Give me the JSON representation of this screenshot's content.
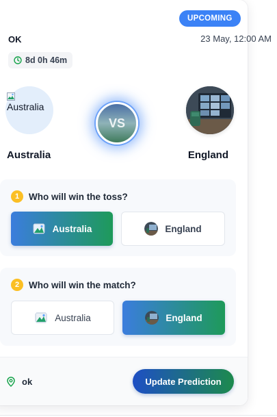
{
  "match": {
    "status_badge": "UPCOMING",
    "name": "OK",
    "datetime": "23 May, 12:00 AM",
    "countdown": "8d 0h 46m",
    "vs_label": "VS"
  },
  "teams": {
    "a": {
      "name": "Australia",
      "avatar_alt": "Australia"
    },
    "b": {
      "name": "England"
    }
  },
  "questions": [
    {
      "number": "1",
      "text": "Who will win the toss?",
      "options": [
        {
          "label": "Australia",
          "selected": true
        },
        {
          "label": "England",
          "selected": false
        }
      ]
    },
    {
      "number": "2",
      "text": "Who will win the match?",
      "options": [
        {
          "label": "Australia",
          "selected": false
        },
        {
          "label": "England",
          "selected": true
        }
      ]
    }
  ],
  "footer": {
    "location": "ok",
    "location_icon": "map-pin-icon",
    "update_button": "Update Prediction"
  },
  "colors": {
    "badge": "#3b82f6",
    "number_dot": "#fbbf24",
    "selected_gradient_start": "#3b7ddd",
    "selected_gradient_end": "#1e9a5a",
    "location_icon": "#16a34a"
  }
}
